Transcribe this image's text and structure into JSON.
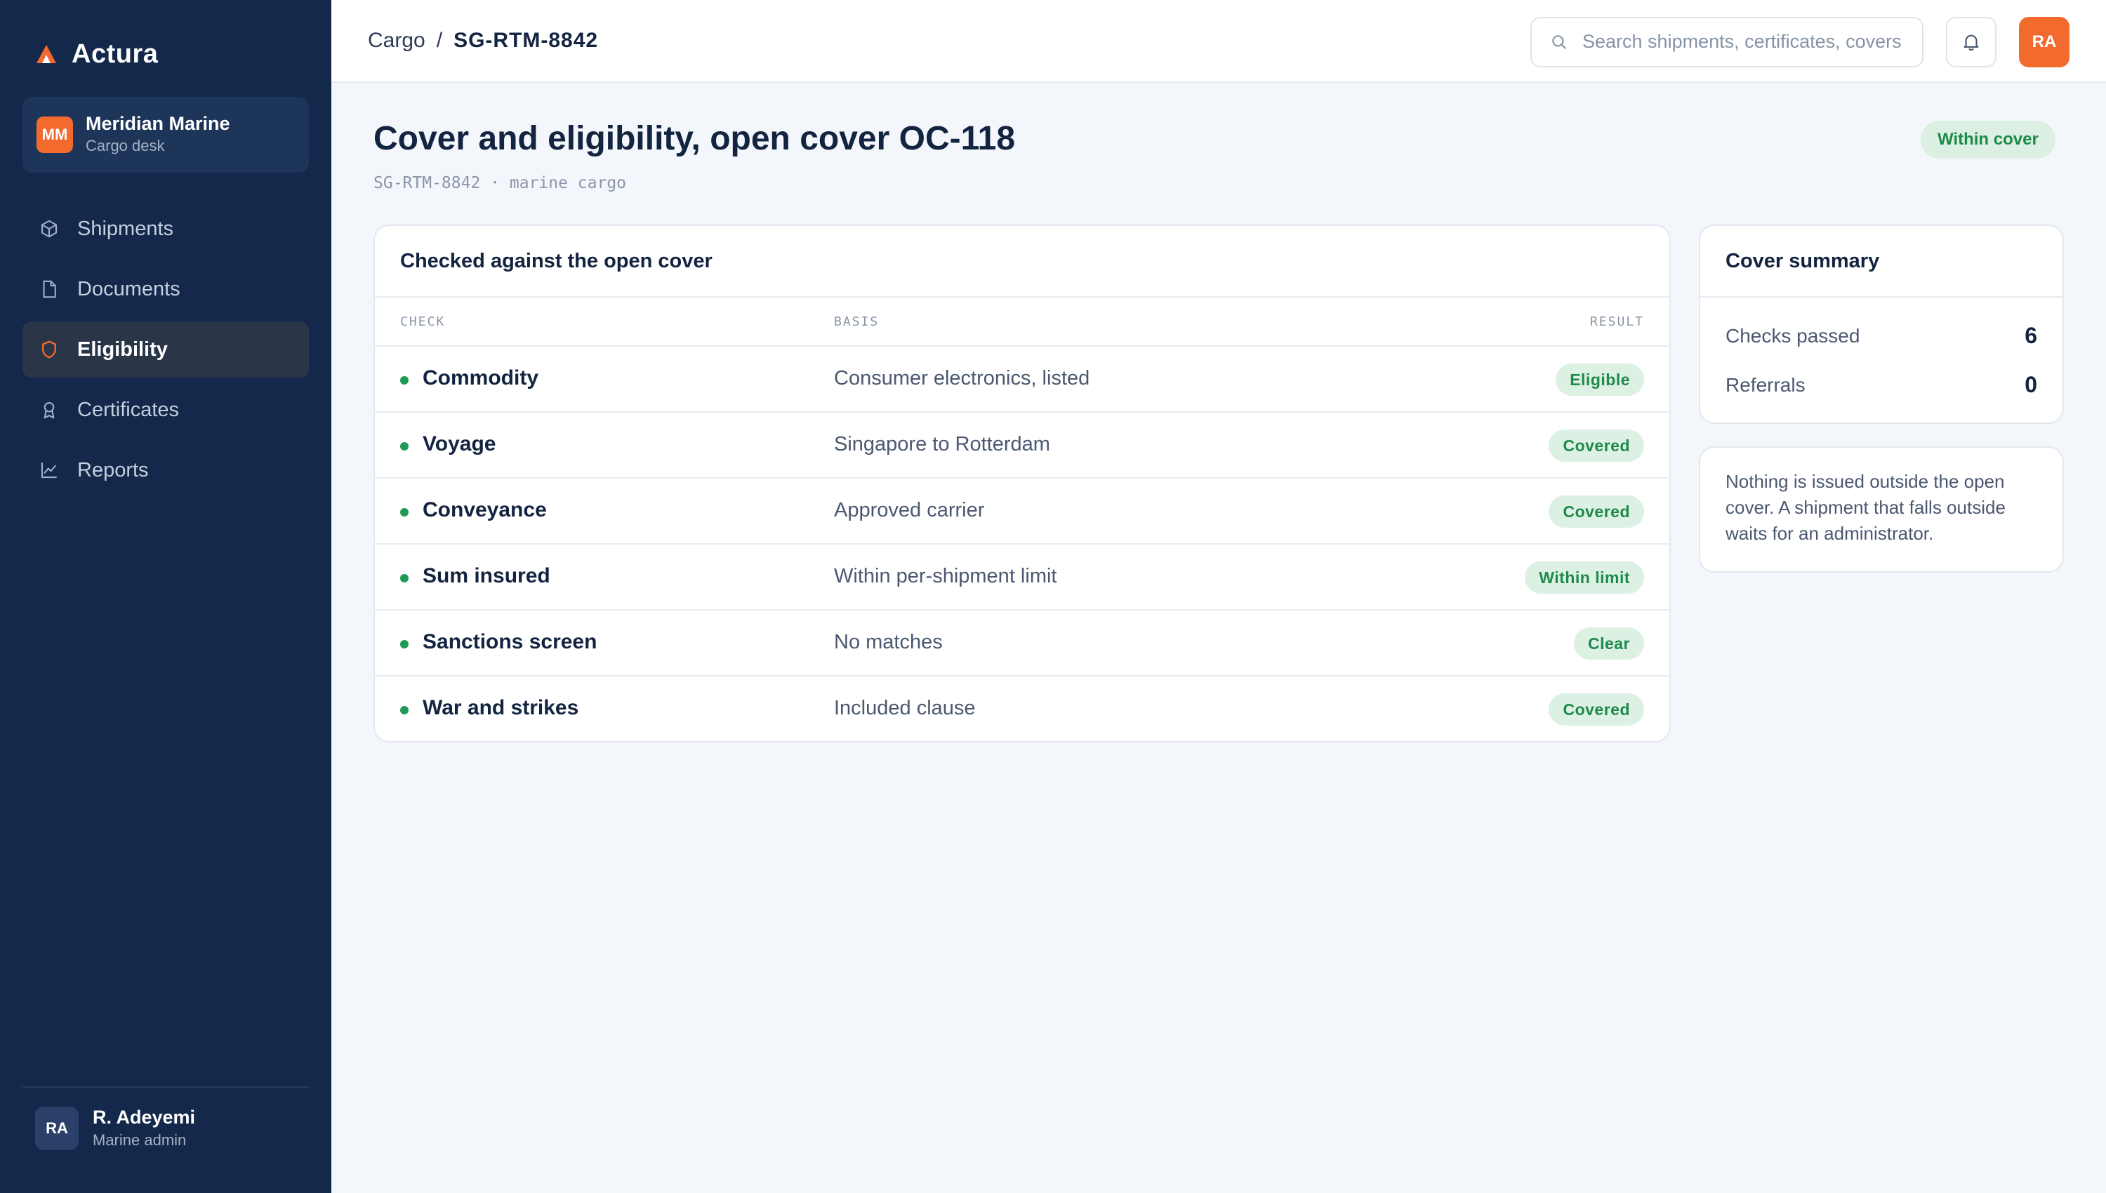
{
  "brand": {
    "name": "Actura",
    "logo_icon": "actura-logo-icon",
    "accent": "#f26a2e"
  },
  "workspace": {
    "initials": "MM",
    "name": "Meridian Marine",
    "role": "Cargo desk"
  },
  "nav": {
    "items": [
      {
        "label": "Shipments",
        "icon": "box-icon",
        "active": false
      },
      {
        "label": "Documents",
        "icon": "document-icon",
        "active": false
      },
      {
        "label": "Eligibility",
        "icon": "shield-icon",
        "active": true
      },
      {
        "label": "Certificates",
        "icon": "award-icon",
        "active": false
      },
      {
        "label": "Reports",
        "icon": "chart-icon",
        "active": false
      }
    ]
  },
  "user": {
    "initials": "RA",
    "name": "R. Adeyemi",
    "role": "Marine admin"
  },
  "topbar": {
    "breadcrumb_parent": "Cargo",
    "breadcrumb_separator": "/",
    "breadcrumb_current": "SG-RTM-8842",
    "search_placeholder": "Search shipments, certificates, covers",
    "avatar_initials": "RA"
  },
  "page": {
    "title": "Cover and eligibility, open cover OC-118",
    "subtitle": "SG-RTM-8842 · marine cargo",
    "status": "Within cover"
  },
  "checks": {
    "heading": "Checked against the open cover",
    "columns": {
      "check": "CHECK",
      "basis": "BASIS",
      "result": "RESULT"
    },
    "rows": [
      {
        "check": "Commodity",
        "basis": "Consumer electronics, listed",
        "result": "Eligible"
      },
      {
        "check": "Voyage",
        "basis": "Singapore to Rotterdam",
        "result": "Covered"
      },
      {
        "check": "Conveyance",
        "basis": "Approved carrier",
        "result": "Covered"
      },
      {
        "check": "Sum insured",
        "basis": "Within per-shipment limit",
        "result": "Within limit"
      },
      {
        "check": "Sanctions screen",
        "basis": "No matches",
        "result": "Clear"
      },
      {
        "check": "War and strikes",
        "basis": "Included clause",
        "result": "Covered"
      }
    ]
  },
  "summary": {
    "heading": "Cover summary",
    "checks_passed_label": "Checks passed",
    "checks_passed_value": "6",
    "referrals_label": "Referrals",
    "referrals_value": "0"
  },
  "note": {
    "text": "Nothing is issued outside the open cover. A shipment that falls outside waits for an administrator."
  },
  "colors": {
    "sidebar_bg": "#13284a",
    "success": "#1e8a4a",
    "success_bg": "#dcf1e4"
  }
}
